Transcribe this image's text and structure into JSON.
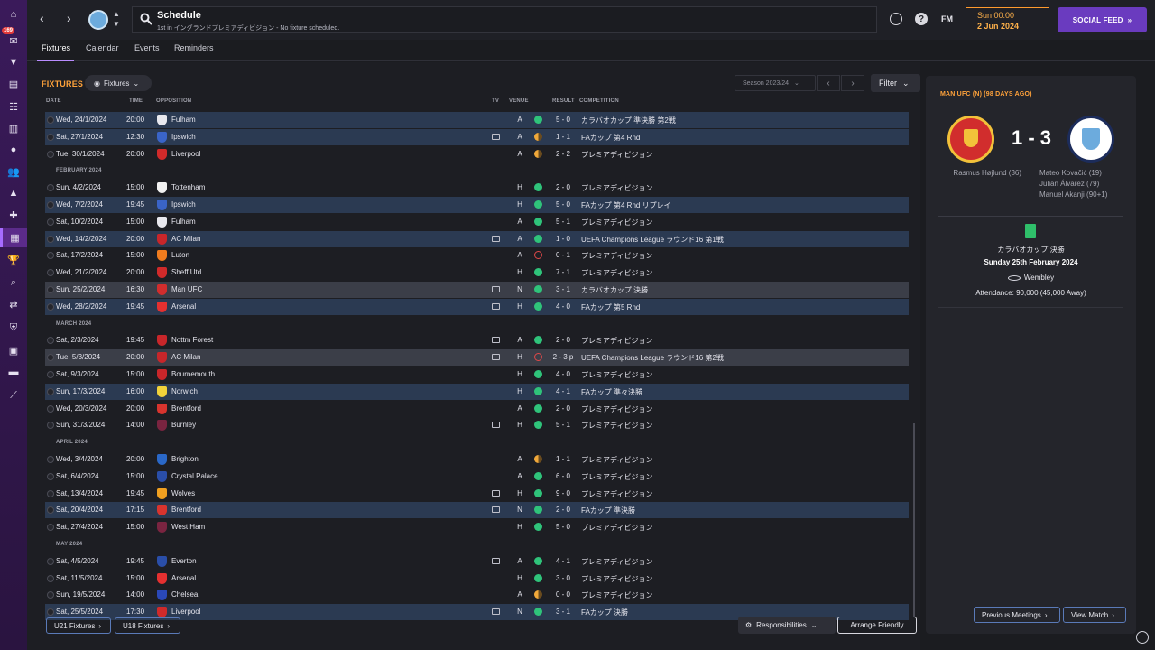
{
  "header": {
    "title": "Schedule",
    "subtitle": "1st in イングランドプレミアディビジョン - No fixture scheduled.",
    "fm_label": "FM",
    "date_line1": "Sun 00:00",
    "date_line2": "2 Jun 2024",
    "social_feed": "SOCIAL FEED",
    "notification_count": "169"
  },
  "tabs": [
    "Fixtures",
    "Calendar",
    "Events",
    "Reminders"
  ],
  "fixtures": {
    "title": "FIXTURES",
    "view_dropdown": "Fixtures",
    "season": "Season 2023/24",
    "filter": "Filter",
    "columns": {
      "date": "DATE",
      "time": "TIME",
      "opposition": "OPPOSITION",
      "tv": "TV",
      "venue": "VENUE",
      "result": "RESULT",
      "competition": "COMPETITION"
    },
    "months": [
      "FEBRUARY 2024",
      "MARCH 2024",
      "APRIL 2024",
      "MAY 2024"
    ],
    "rows": [
      {
        "date": "Wed, 24/1/2024",
        "time": "20:00",
        "opp": "Fulham",
        "tv": false,
        "venue": "A",
        "res": "W",
        "score": "5 - 0",
        "comp": "カラバオカップ 準決勝 第2戦",
        "crest": "#e8e8ee",
        "style": "hl"
      },
      {
        "date": "Sat, 27/1/2024",
        "time": "12:30",
        "opp": "Ipswich",
        "tv": true,
        "venue": "A",
        "res": "D",
        "score": "1 - 1",
        "comp": "FAカップ 第4 Rnd",
        "crest": "#3a64c8",
        "style": "hl"
      },
      {
        "date": "Tue, 30/1/2024",
        "time": "20:00",
        "opp": "Liverpool",
        "tv": false,
        "venue": "A",
        "res": "D",
        "score": "2 - 2",
        "comp": "プレミアディビジョン",
        "crest": "#d02a2a",
        "style": ""
      },
      {
        "date": "Sun, 4/2/2024",
        "time": "15:00",
        "opp": "Tottenham",
        "tv": false,
        "venue": "H",
        "res": "W",
        "score": "2 - 0",
        "comp": "プレミアディビジョン",
        "crest": "#f2f2f2",
        "style": ""
      },
      {
        "date": "Wed, 7/2/2024",
        "time": "19:45",
        "opp": "Ipswich",
        "tv": false,
        "venue": "H",
        "res": "W",
        "score": "5 - 0",
        "comp": "FAカップ 第4 Rnd リプレイ",
        "crest": "#3a64c8",
        "style": "hl"
      },
      {
        "date": "Sat, 10/2/2024",
        "time": "15:00",
        "opp": "Fulham",
        "tv": false,
        "venue": "A",
        "res": "W",
        "score": "5 - 1",
        "comp": "プレミアディビジョン",
        "crest": "#e8e8ee",
        "style": ""
      },
      {
        "date": "Wed, 14/2/2024",
        "time": "20:00",
        "opp": "AC Milan",
        "tv": true,
        "venue": "A",
        "res": "W",
        "score": "1 - 0",
        "comp": "UEFA Champions League ラウンド16 第1戦",
        "crest": "#c8262a",
        "style": "hl"
      },
      {
        "date": "Sat, 17/2/2024",
        "time": "15:00",
        "opp": "Luton",
        "tv": false,
        "venue": "A",
        "res": "L",
        "score": "0 - 1",
        "comp": "プレミアディビジョン",
        "crest": "#f07c1e",
        "style": ""
      },
      {
        "date": "Wed, 21/2/2024",
        "time": "20:00",
        "opp": "Sheff Utd",
        "tv": false,
        "venue": "H",
        "res": "W",
        "score": "7 - 1",
        "comp": "プレミアディビジョン",
        "crest": "#d02a2a",
        "style": ""
      },
      {
        "date": "Sun, 25/2/2024",
        "time": "16:30",
        "opp": "Man UFC",
        "tv": true,
        "venue": "N",
        "res": "W",
        "score": "3 - 1",
        "comp": "カラバオカップ 決勝",
        "crest": "#d12d2d",
        "style": "sel"
      },
      {
        "date": "Wed, 28/2/2024",
        "time": "19:45",
        "opp": "Arsenal",
        "tv": true,
        "venue": "H",
        "res": "W",
        "score": "4 - 0",
        "comp": "FAカップ 第5 Rnd",
        "crest": "#e53030",
        "style": "hl"
      },
      {
        "date": "Sat, 2/3/2024",
        "time": "19:45",
        "opp": "Nottm Forest",
        "tv": true,
        "venue": "A",
        "res": "W",
        "score": "2 - 0",
        "comp": "プレミアディビジョン",
        "crest": "#c8262a",
        "style": ""
      },
      {
        "date": "Tue, 5/3/2024",
        "time": "20:00",
        "opp": "AC Milan",
        "tv": true,
        "venue": "H",
        "res": "L",
        "score": "2 - 3 p",
        "comp": "UEFA Champions League ラウンド16 第2戦",
        "crest": "#c8262a",
        "style": "sel"
      },
      {
        "date": "Sat, 9/3/2024",
        "time": "15:00",
        "opp": "Bournemouth",
        "tv": false,
        "venue": "H",
        "res": "W",
        "score": "4 - 0",
        "comp": "プレミアディビジョン",
        "crest": "#c8262a",
        "style": ""
      },
      {
        "date": "Sun, 17/3/2024",
        "time": "16:00",
        "opp": "Norwich",
        "tv": false,
        "venue": "H",
        "res": "W",
        "score": "4 - 1",
        "comp": "FAカップ 準々決勝",
        "crest": "#f2d23a",
        "style": "hl"
      },
      {
        "date": "Wed, 20/3/2024",
        "time": "20:00",
        "opp": "Brentford",
        "tv": false,
        "venue": "A",
        "res": "W",
        "score": "2 - 0",
        "comp": "プレミアディビジョン",
        "crest": "#d8342e",
        "style": ""
      },
      {
        "date": "Sun, 31/3/2024",
        "time": "14:00",
        "opp": "Burnley",
        "tv": true,
        "venue": "H",
        "res": "W",
        "score": "5 - 1",
        "comp": "プレミアディビジョン",
        "crest": "#7a2440",
        "style": ""
      },
      {
        "date": "Wed, 3/4/2024",
        "time": "20:00",
        "opp": "Brighton",
        "tv": false,
        "venue": "A",
        "res": "D",
        "score": "1 - 1",
        "comp": "プレミアディビジョン",
        "crest": "#2a68c8",
        "style": ""
      },
      {
        "date": "Sat, 6/4/2024",
        "time": "15:00",
        "opp": "Crystal Palace",
        "tv": false,
        "venue": "A",
        "res": "W",
        "score": "6 - 0",
        "comp": "プレミアディビジョン",
        "crest": "#2a4ea8",
        "style": ""
      },
      {
        "date": "Sat, 13/4/2024",
        "time": "19:45",
        "opp": "Wolves",
        "tv": true,
        "venue": "H",
        "res": "W",
        "score": "9 - 0",
        "comp": "プレミアディビジョン",
        "crest": "#f0a020",
        "style": ""
      },
      {
        "date": "Sat, 20/4/2024",
        "time": "17:15",
        "opp": "Brentford",
        "tv": true,
        "venue": "N",
        "res": "W",
        "score": "2 - 0",
        "comp": "FAカップ 準決勝",
        "crest": "#d8342e",
        "style": "hl"
      },
      {
        "date": "Sat, 27/4/2024",
        "time": "15:00",
        "opp": "West Ham",
        "tv": false,
        "venue": "H",
        "res": "W",
        "score": "5 - 0",
        "comp": "プレミアディビジョン",
        "crest": "#7a2440",
        "style": ""
      },
      {
        "date": "Sat, 4/5/2024",
        "time": "19:45",
        "opp": "Everton",
        "tv": true,
        "venue": "A",
        "res": "W",
        "score": "4 - 1",
        "comp": "プレミアディビジョン",
        "crest": "#2a4ea8",
        "style": ""
      },
      {
        "date": "Sat, 11/5/2024",
        "time": "15:00",
        "opp": "Arsenal",
        "tv": false,
        "venue": "H",
        "res": "W",
        "score": "3 - 0",
        "comp": "プレミアディビジョン",
        "crest": "#e53030",
        "style": ""
      },
      {
        "date": "Sun, 19/5/2024",
        "time": "14:00",
        "opp": "Chelsea",
        "tv": false,
        "venue": "A",
        "res": "D",
        "score": "0 - 0",
        "comp": "プレミアディビジョン",
        "crest": "#2a48b8",
        "style": ""
      },
      {
        "date": "Sat, 25/5/2024",
        "time": "17:30",
        "opp": "Liverpool",
        "tv": true,
        "venue": "N",
        "res": "W",
        "score": "3 - 1",
        "comp": "FAカップ 決勝",
        "crest": "#d02a2a",
        "style": "hl"
      }
    ],
    "u21_button": "U21 Fixtures",
    "u18_button": "U18 Fixtures",
    "responsibilities": "Responsibilities",
    "arrange_friendly": "Arrange Friendly"
  },
  "match_panel": {
    "title": "MAN UFC (N) (98 DAYS AGO)",
    "score": "1 - 3",
    "home_scorers": [
      "Rasmus Højlund (36)"
    ],
    "away_scorers": [
      "Mateo Kovačić (19)",
      "Julián Álvarez (79)",
      "Manuel Akanji (90+1)"
    ],
    "competition": "カラバオカップ 決勝",
    "date": "Sunday 25th February 2024",
    "stadium": "Wembley",
    "attendance": "Attendance: 90,000 (45,000 Away)",
    "previous_meetings": "Previous Meetings",
    "view_match": "View Match"
  },
  "colors": {
    "accent": "#6a3bbf",
    "orange": "#ffa23a",
    "win": "#2fc37a",
    "draw": "#f0a83a",
    "loss": "#e04848",
    "row_highlight": "#2b3a52"
  }
}
